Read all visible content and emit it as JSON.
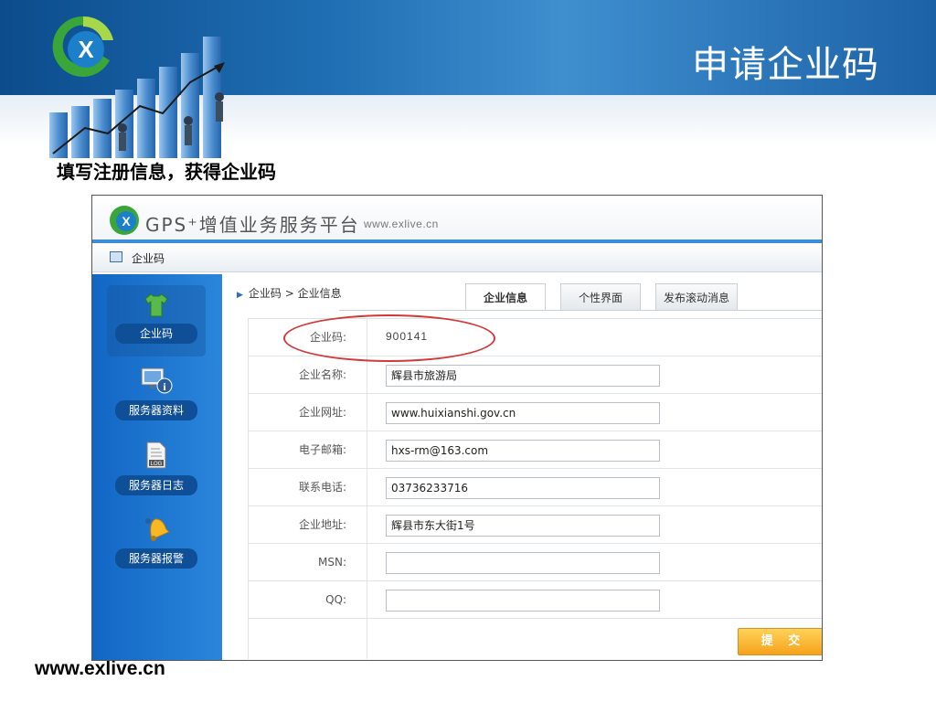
{
  "slide": {
    "title": "申请企业码",
    "subtitle": "填写注册信息，获得企业码",
    "footer_url": "www.exlive.cn"
  },
  "app": {
    "title": "GPS⁺增值业务服务平台",
    "url": "www.exlive.cn",
    "crumbbar_label": "企业码",
    "breadcrumb": "企业码 > 企业信息",
    "tabs": [
      {
        "label": "企业信息",
        "active": true
      },
      {
        "label": "个性界面",
        "active": false
      },
      {
        "label": "发布滚动消息",
        "active": false
      }
    ],
    "sidebar": {
      "items": [
        {
          "label": "企业码",
          "icon": "shirt-icon",
          "active": true
        },
        {
          "label": "服务器资料",
          "icon": "monitor-info-icon",
          "active": false
        },
        {
          "label": "服务器日志",
          "icon": "log-file-icon",
          "active": false
        },
        {
          "label": "服务器报警",
          "icon": "bell-icon",
          "active": false
        }
      ]
    },
    "form": {
      "rows": [
        {
          "label": "企业码:",
          "value": "900141",
          "type": "text"
        },
        {
          "label": "企业名称:",
          "value": "辉县市旅游局",
          "type": "input"
        },
        {
          "label": "企业网址:",
          "value": "www.huixianshi.gov.cn",
          "type": "input"
        },
        {
          "label": "电子邮箱:",
          "value": "hxs-rm@163.com",
          "type": "input"
        },
        {
          "label": "联系电话:",
          "value": "03736233716",
          "type": "input"
        },
        {
          "label": "企业地址:",
          "value": "辉县市东大街1号",
          "type": "input"
        },
        {
          "label": "MSN:",
          "value": "",
          "type": "input"
        },
        {
          "label": "QQ:",
          "value": "",
          "type": "input"
        }
      ],
      "submit_label": "提 交"
    }
  },
  "colors": {
    "header_blue": "#1f6eb3",
    "sidebar_blue": "#1266c4",
    "submit_orange": "#f5a21b",
    "highlight_red": "#d23a3a"
  }
}
